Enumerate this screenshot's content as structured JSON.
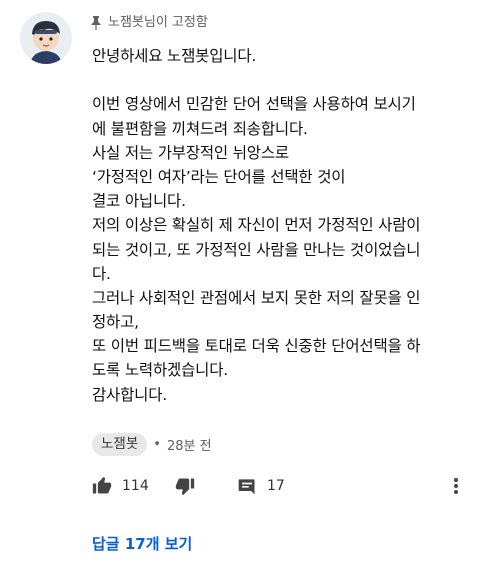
{
  "comment": {
    "pinned_label": "노잼봇님이 고정함",
    "lines": [
      "안녕하세요 노잼봇입니다.",
      "",
      "이번 영상에서 민감한 단어 선택을 사용하여 보시기",
      "에 불편함을 끼쳐드려 죄송합니다.",
      "사실 저는 가부장적인 뉘앙스로",
      "‘가정적인 여자’라는 단어를 선택한 것이",
      "결코 아닙니다.",
      "저의 이상은 확실히 제 자신이 먼저 가정적인 사람이",
      "되는 것이고, 또 가정적인 사람을 만나는 것이었습니",
      "다.",
      "그러나 사회적인 관점에서 보지 못한 저의 잘못을 인",
      "정하고,",
      "또 이번 피드백을 토대로 더욱 신중한 단어선택을 하",
      "도록 노력하겠습니다.",
      "감사합니다."
    ],
    "author": "노잼봇",
    "separator": "•",
    "time": "28분 전",
    "likes": "114",
    "reply_count": "17",
    "view_replies": "답글 17개 보기"
  },
  "icons": {
    "pin": "pin-icon",
    "like": "thumbs-up-icon",
    "dislike": "thumbs-down-icon",
    "reply": "comment-icon",
    "more": "more-vert-icon"
  },
  "colors": {
    "link": "#065fd4",
    "secondary_text": "#606060",
    "chip_bg": "#e8e8e8"
  }
}
